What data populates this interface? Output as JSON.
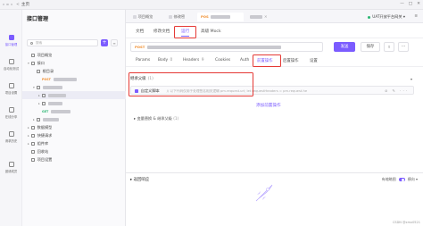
{
  "titlebar": {
    "back": "<",
    "app_name": "主页",
    "controls": [
      "—",
      "□",
      "✕"
    ]
  },
  "rail": [
    {
      "label": "接口管理",
      "icon": "api-icon",
      "active": true
    },
    {
      "label": "自动化测试",
      "icon": "test-icon",
      "active": false
    },
    {
      "label": "项目设置",
      "icon": "settings-icon",
      "active": false
    },
    {
      "label": "在线分享",
      "icon": "share-icon",
      "active": false
    },
    {
      "label": "请求历史",
      "icon": "history-icon",
      "active": false
    },
    {
      "label": "邀请成员",
      "icon": "member-icon",
      "active": false
    }
  ],
  "tree": {
    "title": "接口管理",
    "search_placeholder": "搜索",
    "add_label": "+",
    "filter_label": "≡",
    "rows": [
      {
        "label": "项目概览",
        "method": "",
        "depth": 0,
        "icon": "overview-icon"
      },
      {
        "label": "接口",
        "method": "",
        "depth": 0,
        "icon": "folder-icon",
        "chev": "▾"
      },
      {
        "label": "根目录",
        "method": "",
        "depth": 1,
        "icon": "folder-icon"
      },
      {
        "label": "",
        "method": "POST",
        "depth": 2,
        "blur": 26
      },
      {
        "label": "",
        "method": "",
        "depth": 1,
        "icon": "folder-icon",
        "blur": 22,
        "chev": "▾"
      },
      {
        "label": "",
        "method": "",
        "depth": 2,
        "icon": "folder-icon",
        "blur": 20,
        "chev": "▸",
        "selected": true
      },
      {
        "label": "",
        "method": "",
        "depth": 2,
        "icon": "folder-icon",
        "blur": 16,
        "chev": "▸"
      },
      {
        "label": "",
        "method": "GET",
        "depth": 2,
        "blur": 22
      },
      {
        "label": "",
        "method": "",
        "depth": 1,
        "icon": "folder-icon",
        "blur": 18,
        "chev": "▸"
      },
      {
        "label": "数据模型",
        "method": "",
        "depth": 0,
        "icon": "model-icon",
        "chev": "▸"
      },
      {
        "label": "快捷请求",
        "method": "",
        "depth": 0,
        "icon": "quick-icon",
        "chev": "▸"
      },
      {
        "label": "组件库",
        "method": "",
        "depth": 0,
        "icon": "component-icon",
        "chev": "▸"
      },
      {
        "label": "回收站",
        "method": "",
        "depth": 0,
        "icon": "trash-icon"
      },
      {
        "label": "项目设置",
        "method": "",
        "depth": 0,
        "icon": "settings-icon"
      }
    ]
  },
  "tabs": {
    "items": [
      {
        "label": "项目概览",
        "active": false
      },
      {
        "label": "修改密",
        "active": false
      },
      {
        "label": "POS",
        "active": true
      }
    ],
    "env": "UAT开放平台网关",
    "menu": "≡"
  },
  "subtabs": [
    "文档",
    "修改文档",
    "运行",
    "高级 Mock"
  ],
  "url": {
    "method": "POST"
  },
  "buttons": {
    "send": "发送",
    "save": "保存",
    "share": "⇪",
    "more": "···"
  },
  "param_tabs": [
    {
      "label": "Params",
      "count": ""
    },
    {
      "label": "Body",
      "count": "0"
    },
    {
      "label": "Headers",
      "count": "9"
    },
    {
      "label": "Cookies",
      "count": ""
    },
    {
      "label": "Auth",
      "count": ""
    },
    {
      "label": "前置操作",
      "count": ""
    },
    {
      "label": "后置操作",
      "count": ""
    },
    {
      "label": "设置",
      "count": ""
    }
  ],
  "preop": {
    "title": "继承父级",
    "count": "(1)",
    "item_label": "自定义脚本",
    "item_hint": "// 以下代码仅用于处理签名相关逻辑 pm.request.url; let requestHeaders = pm.request.he",
    "actions": "⊘ ✎ ···",
    "add_label": "添加前置操作",
    "var_label": "变量替换 & 继承父级",
    "var_count": "(1)"
  },
  "response": {
    "title": "返回响应",
    "right_label": "有缩略图",
    "mode": "横向"
  },
  "watermark": "CSDN @xmx0521"
}
